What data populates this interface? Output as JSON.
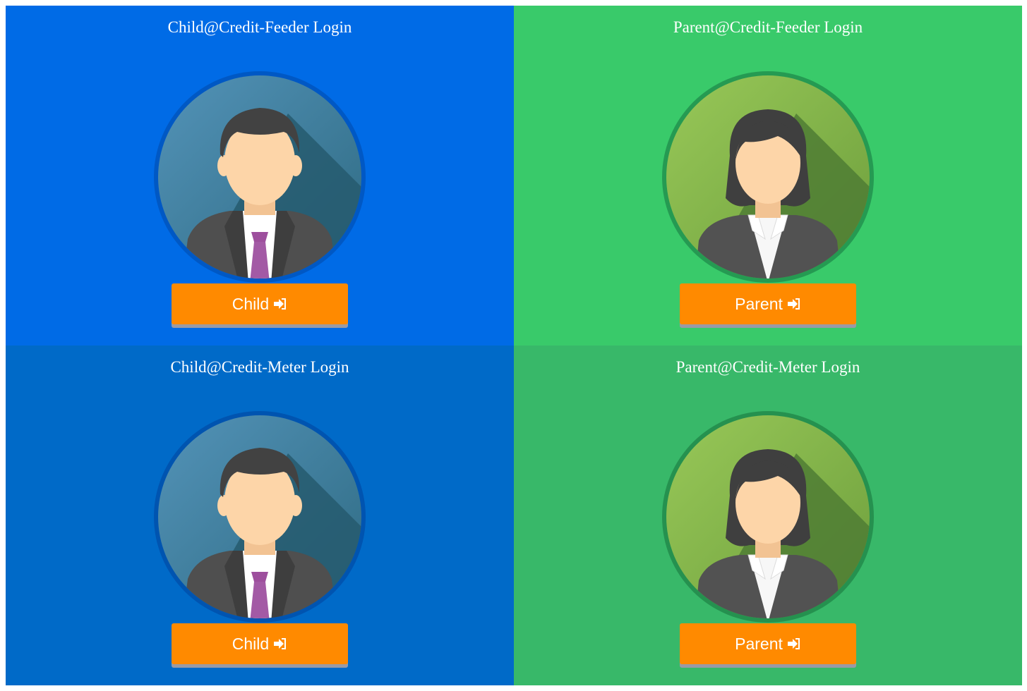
{
  "panels": [
    {
      "title": "Child@Credit-Feeder Login",
      "button_label": "Child",
      "avatar": "male-avatar",
      "button_icon": "sign-in-icon"
    },
    {
      "title": "Parent@Credit-Feeder Login",
      "button_label": "Parent",
      "avatar": "female-avatar",
      "button_icon": "sign-in-icon"
    },
    {
      "title": "Child@Credit-Meter Login",
      "button_label": "Child",
      "avatar": "male-avatar",
      "button_icon": "sign-in-icon"
    },
    {
      "title": "Parent@Credit-Meter Login",
      "button_label": "Parent",
      "avatar": "female-avatar",
      "button_icon": "sign-in-icon"
    }
  ],
  "colors": {
    "child_feeder_bg": "#006be6",
    "parent_feeder_bg": "#39ca6a",
    "child_meter_bg": "#006ac8",
    "parent_meter_bg": "#38b869",
    "button": "#ff8a00"
  }
}
